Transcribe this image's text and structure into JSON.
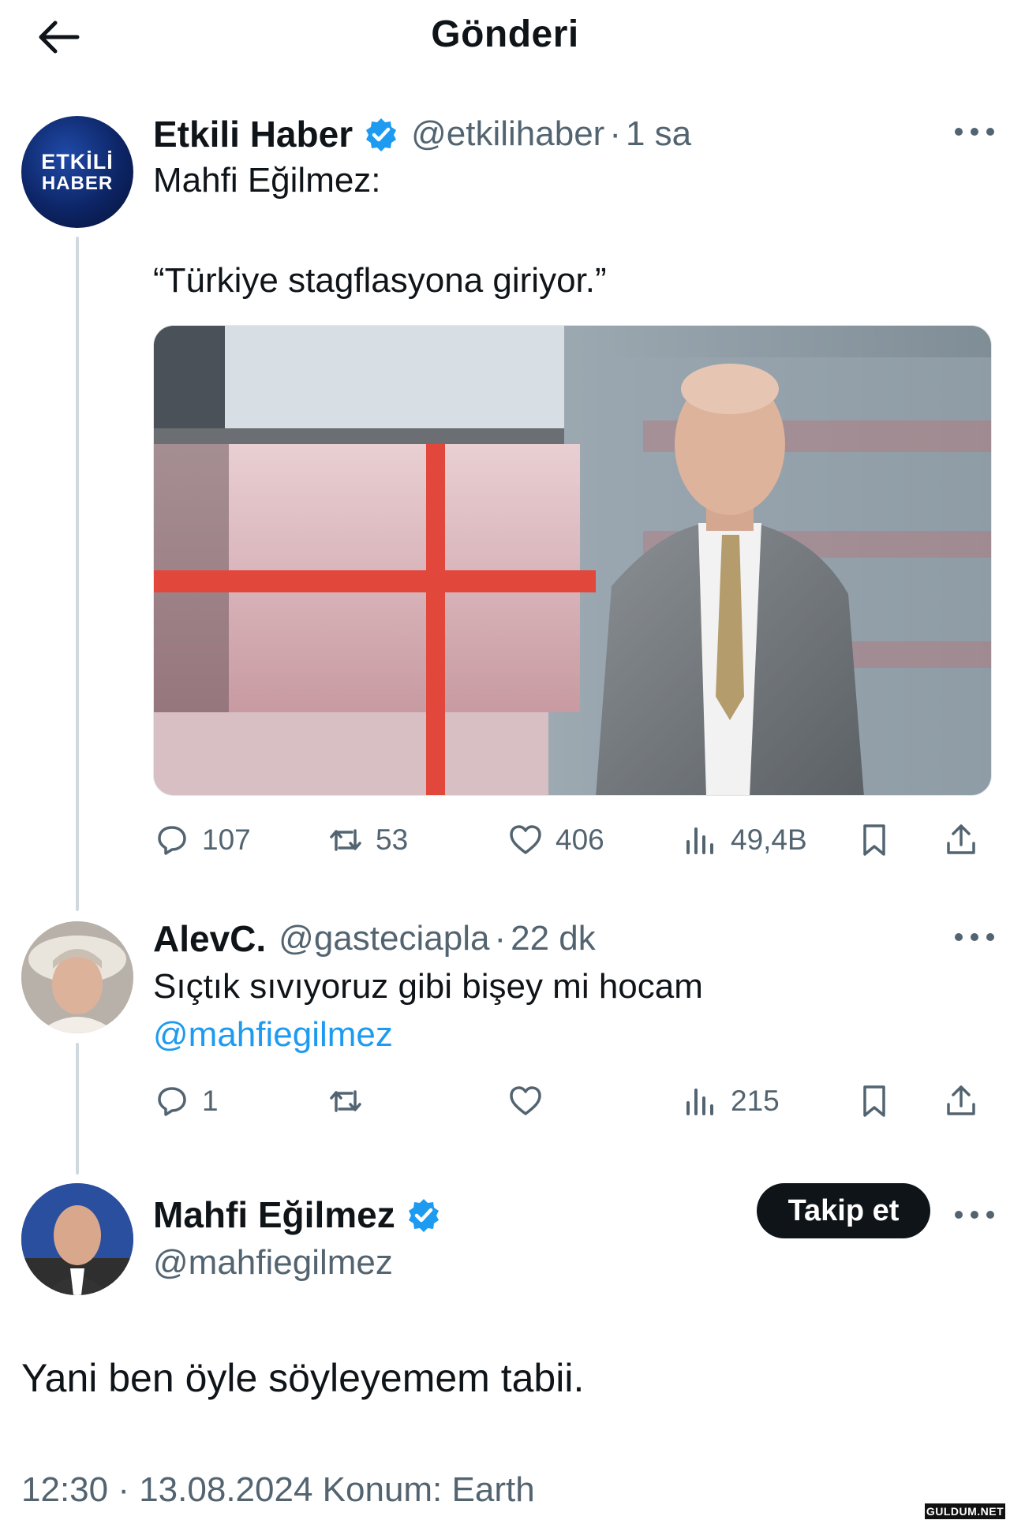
{
  "header": {
    "title": "Gönderi",
    "back_icon": "arrow-left-icon"
  },
  "colors": {
    "accent": "#1d9bf0",
    "text": "#0f1419",
    "muted": "#536471",
    "thread_line": "#cfd9de"
  },
  "tweet1": {
    "display_name": "Etkili Haber",
    "handle": "@etkilihaber",
    "separator": "·",
    "time": "1 sa",
    "avatar_line1": "ETKİLİ",
    "avatar_line2": "HABER",
    "text_line1": "Mahfi Eğilmez:",
    "text_line2": "“Türkiye stagflasyona giriyor.”",
    "stats": {
      "replies": "107",
      "retweets": "53",
      "likes": "406",
      "views": "49,4B"
    }
  },
  "tweet2": {
    "display_name": "AlevC.",
    "handle": "@gasteciapla",
    "separator": "·",
    "time": "22 dk",
    "text_line1": "Sıçtık sıvıyoruz gibi bişey mi hocam",
    "mention": "@mahfiegilmez",
    "stats": {
      "replies": "1",
      "views": "215"
    }
  },
  "tweet3": {
    "display_name": "Mahfi Eğilmez",
    "handle": "@mahfiegilmez",
    "follow_label": "Takip et",
    "text": "Yani ben öyle söyleyemem tabii.",
    "meta": "12:30 · 13.08.2024 Konum: Earth"
  },
  "watermark": "GULDUM.NET"
}
